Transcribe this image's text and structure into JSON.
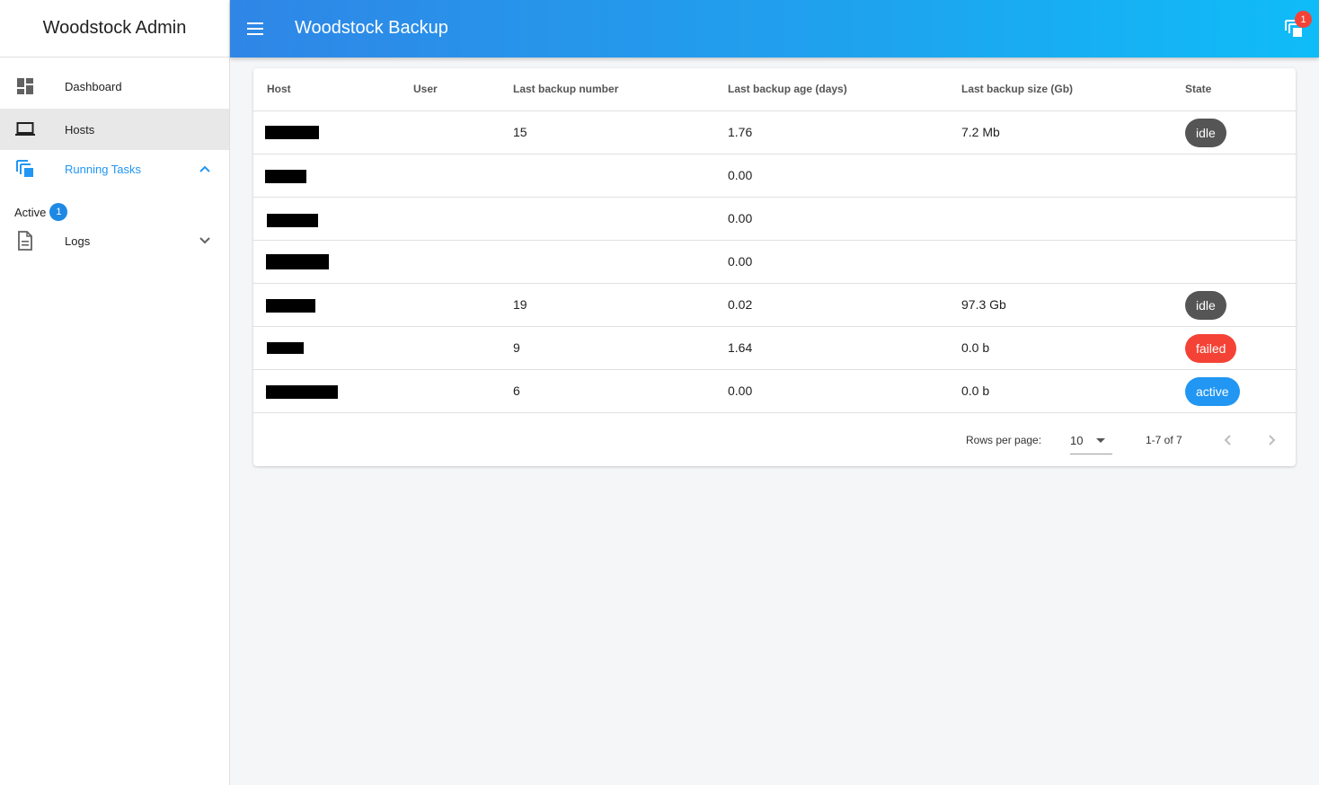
{
  "sidebar": {
    "title": "Woodstock Admin",
    "items": [
      {
        "label": "Dashboard",
        "icon": "dashboard-icon"
      },
      {
        "label": "Hosts",
        "icon": "laptop-icon"
      },
      {
        "label": "Running Tasks",
        "icon": "tasks-icon"
      },
      {
        "label": "Logs",
        "icon": "document-icon"
      }
    ],
    "active_label": "Active",
    "active_count": "1"
  },
  "topbar": {
    "title": "Woodstock Backup",
    "tasks_count": "1"
  },
  "table": {
    "headers": [
      "Host",
      "User",
      "Last backup number",
      "Last backup age (days)",
      "Last backup size (Gb)",
      "State"
    ],
    "rows": [
      {
        "host": "[redacted]",
        "user": "",
        "number": "15",
        "age": "1.76",
        "size": "7.2 Mb",
        "state": "idle"
      },
      {
        "host": "[redacted]",
        "user": "",
        "number": "",
        "age": "0.00",
        "size": "",
        "state": ""
      },
      {
        "host": "[redacted]",
        "user": "",
        "number": "",
        "age": "0.00",
        "size": "",
        "state": ""
      },
      {
        "host": "[redacted]",
        "user": "",
        "number": "",
        "age": "0.00",
        "size": "",
        "state": ""
      },
      {
        "host": "[redacted]",
        "user": "",
        "number": "19",
        "age": "0.02",
        "size": "97.3 Gb",
        "state": "idle"
      },
      {
        "host": "[redacted]",
        "user": "",
        "number": "9",
        "age": "1.64",
        "size": "0.0 b",
        "state": "failed"
      },
      {
        "host": "[redacted]",
        "user": "",
        "number": "6",
        "age": "0.00",
        "size": "0.0 b",
        "state": "active"
      }
    ]
  },
  "pagination": {
    "rows_per_page_label": "Rows per page:",
    "rows_per_page_value": "10",
    "range": "1-7 of 7"
  },
  "colors": {
    "accent": "#2196f3",
    "idle": "#555555",
    "failed": "#f44336",
    "active": "#2196f3",
    "badge": "#1e88e5"
  }
}
